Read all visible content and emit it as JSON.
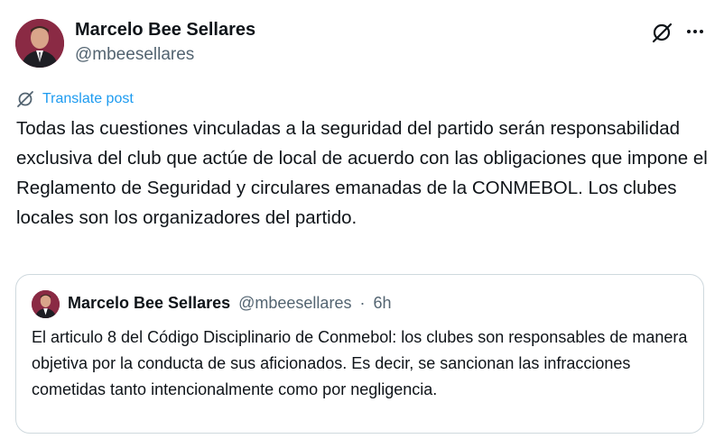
{
  "post": {
    "author_name": "Marcelo Bee Sellares",
    "author_handle": "@mbeesellares",
    "avatar_icon": "profile-photo",
    "translate_label": "Translate post",
    "text": "Todas las cuestiones vinculadas a la seguridad del partido serán responsabilidad exclusiva del club que actúe de local de acuerdo con las obligaciones que impone el Reglamento de Seguridad y circulares emanadas de la CONMEBOL. Los clubes locales son los organizadores del partido."
  },
  "quoted_post": {
    "author_name": "Marcelo Bee Sellares",
    "author_handle": "@mbeesellares",
    "separator": "·",
    "time": "6h",
    "text": "El articulo 8 del Código Disciplinario de Conmebol: los clubes son responsables de manera objetiva por la conducta de sus aficionados. Es decir, se sancionan las infracciones cometidas tanto intencionalmente como por negligencia."
  },
  "icons": {
    "grok": "grok-icon",
    "more": "more-icon",
    "translate": "translate-icon"
  },
  "colors": {
    "text": "#0f1419",
    "secondary": "#536471",
    "link": "#1d9bf0",
    "border": "#cfd9de"
  }
}
